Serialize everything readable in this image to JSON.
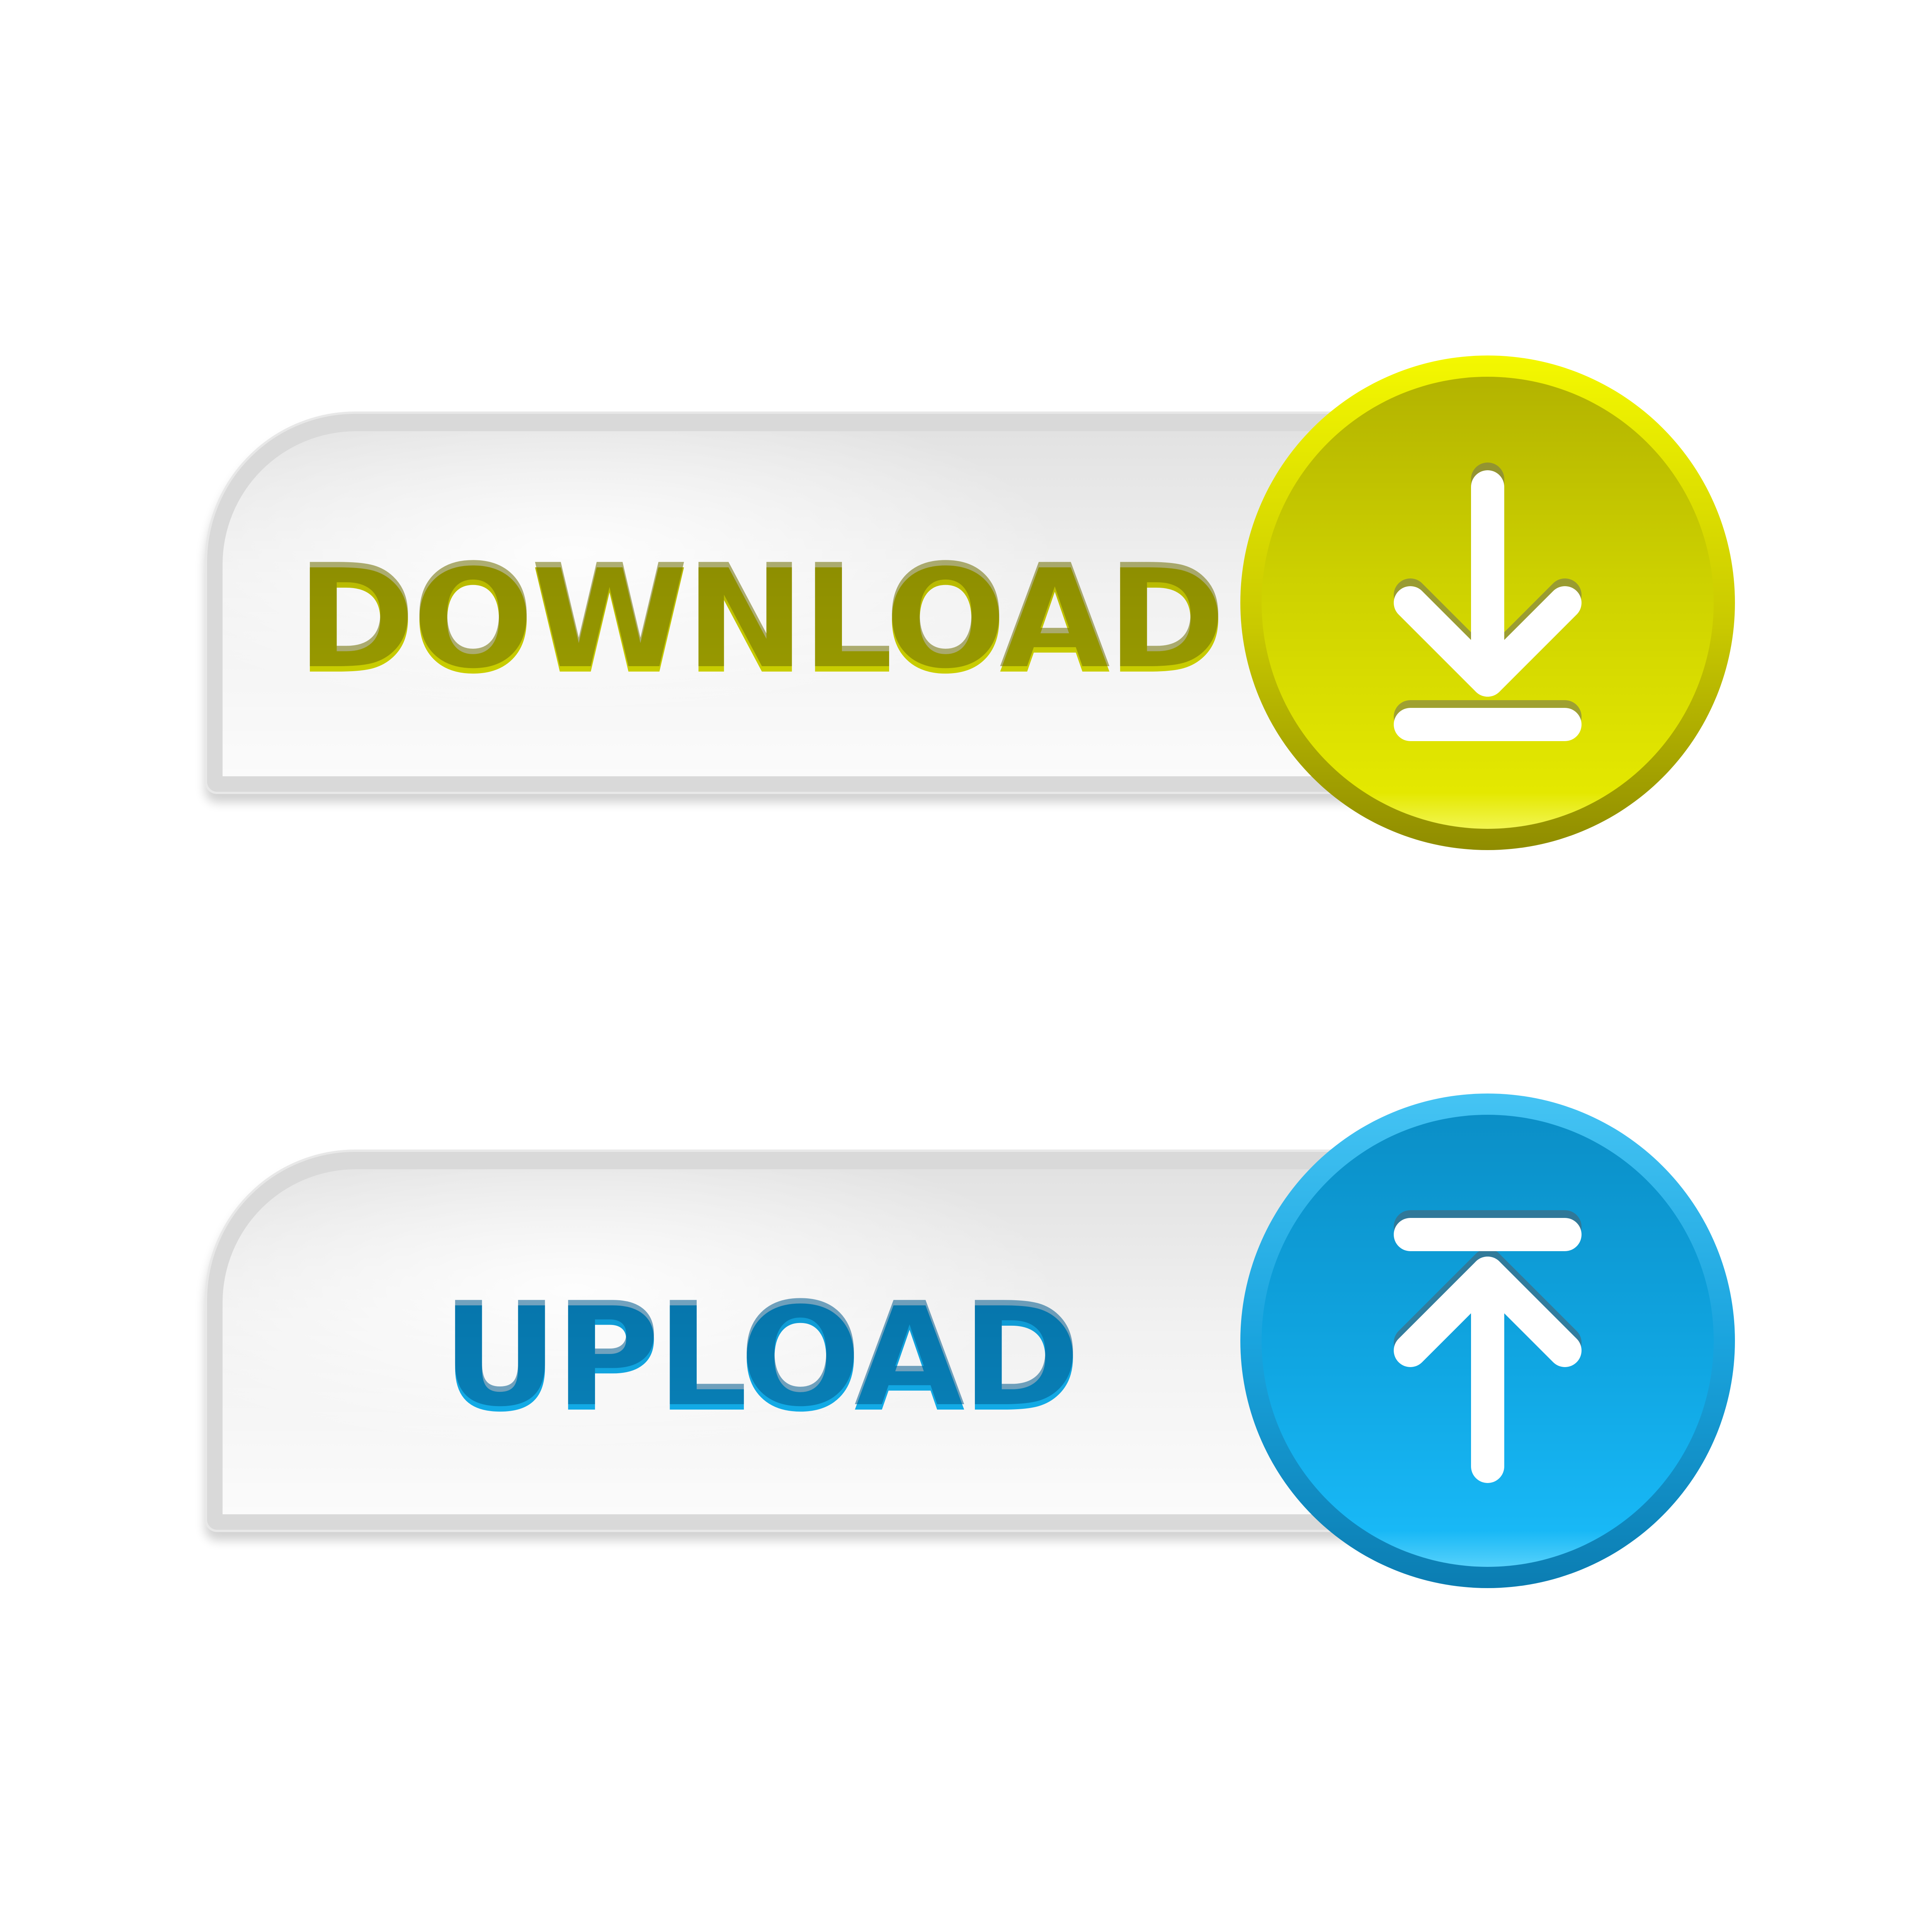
{
  "download": {
    "label": "DOWNLOAD",
    "icon": "download-arrow-icon",
    "accent": "#d4dc00"
  },
  "upload": {
    "label": "UPLOAD",
    "icon": "upload-arrow-icon",
    "accent": "#10aee8"
  }
}
